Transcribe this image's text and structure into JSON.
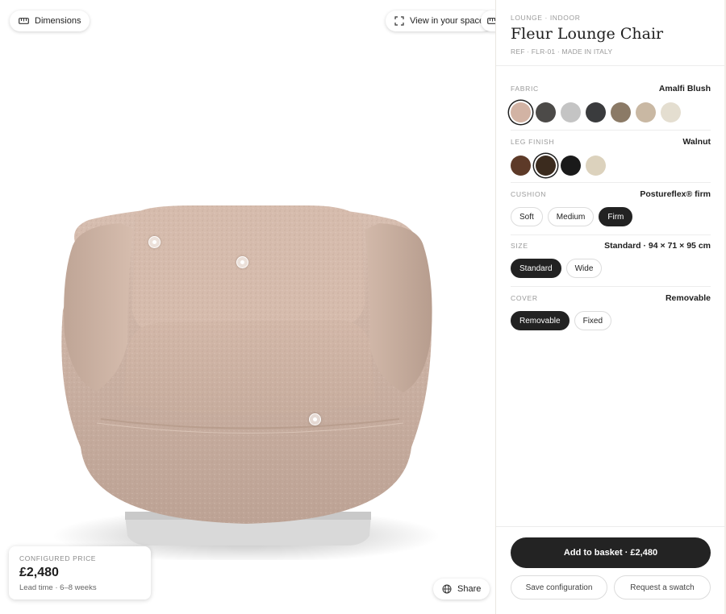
{
  "viewer": {
    "dimensions_label": "Dimensions",
    "ar_label": "View in your space",
    "share_label": "Share",
    "icons": [
      "ruler-icon",
      "expand-icon",
      "globe-icon"
    ]
  },
  "price_card": {
    "label": "CONFIGURED PRICE",
    "value": "£2,480",
    "lead_time": "Lead time · 6–8 weeks"
  },
  "product": {
    "eyebrow": "LOUNGE · INDOOR",
    "title": "Fleur Lounge Chair",
    "ref": "REF · FLR-01 · MADE IN ITALY"
  },
  "options": {
    "fabric": {
      "label": "FABRIC",
      "value": "Amalfi Blush",
      "swatches": [
        "#d2b3a4",
        "#4c4a48",
        "#c4c4c4",
        "#3a3b3d",
        "#8b7a66",
        "#c9b8a3",
        "#e4ded0"
      ],
      "selected": 0
    },
    "leg": {
      "label": "LEG FINISH",
      "value": "Walnut",
      "swatches": [
        "#5d3a28",
        "#3b2b1e",
        "#1a1a1a",
        "#dcd2bd"
      ],
      "selected": 1
    },
    "cushion": {
      "label": "CUSHION",
      "value": "Postureflex® firm",
      "chips": [
        "Soft",
        "Medium",
        "Firm"
      ],
      "selected": 2
    },
    "size": {
      "label": "SIZE",
      "value": "Standard · 94 × 71 × 95 cm",
      "chips": [
        "Standard",
        "Wide"
      ],
      "selected": 0
    },
    "cover": {
      "label": "COVER",
      "value": "Removable",
      "chips": [
        "Removable",
        "Fixed"
      ],
      "selected": 0
    }
  },
  "actions": {
    "basket": "Add to basket · £2,480",
    "save": "Save configuration",
    "swatch": "Request a swatch"
  },
  "colors": {
    "upholstery": "#cdb3a4",
    "accent_dark": "#222222"
  }
}
